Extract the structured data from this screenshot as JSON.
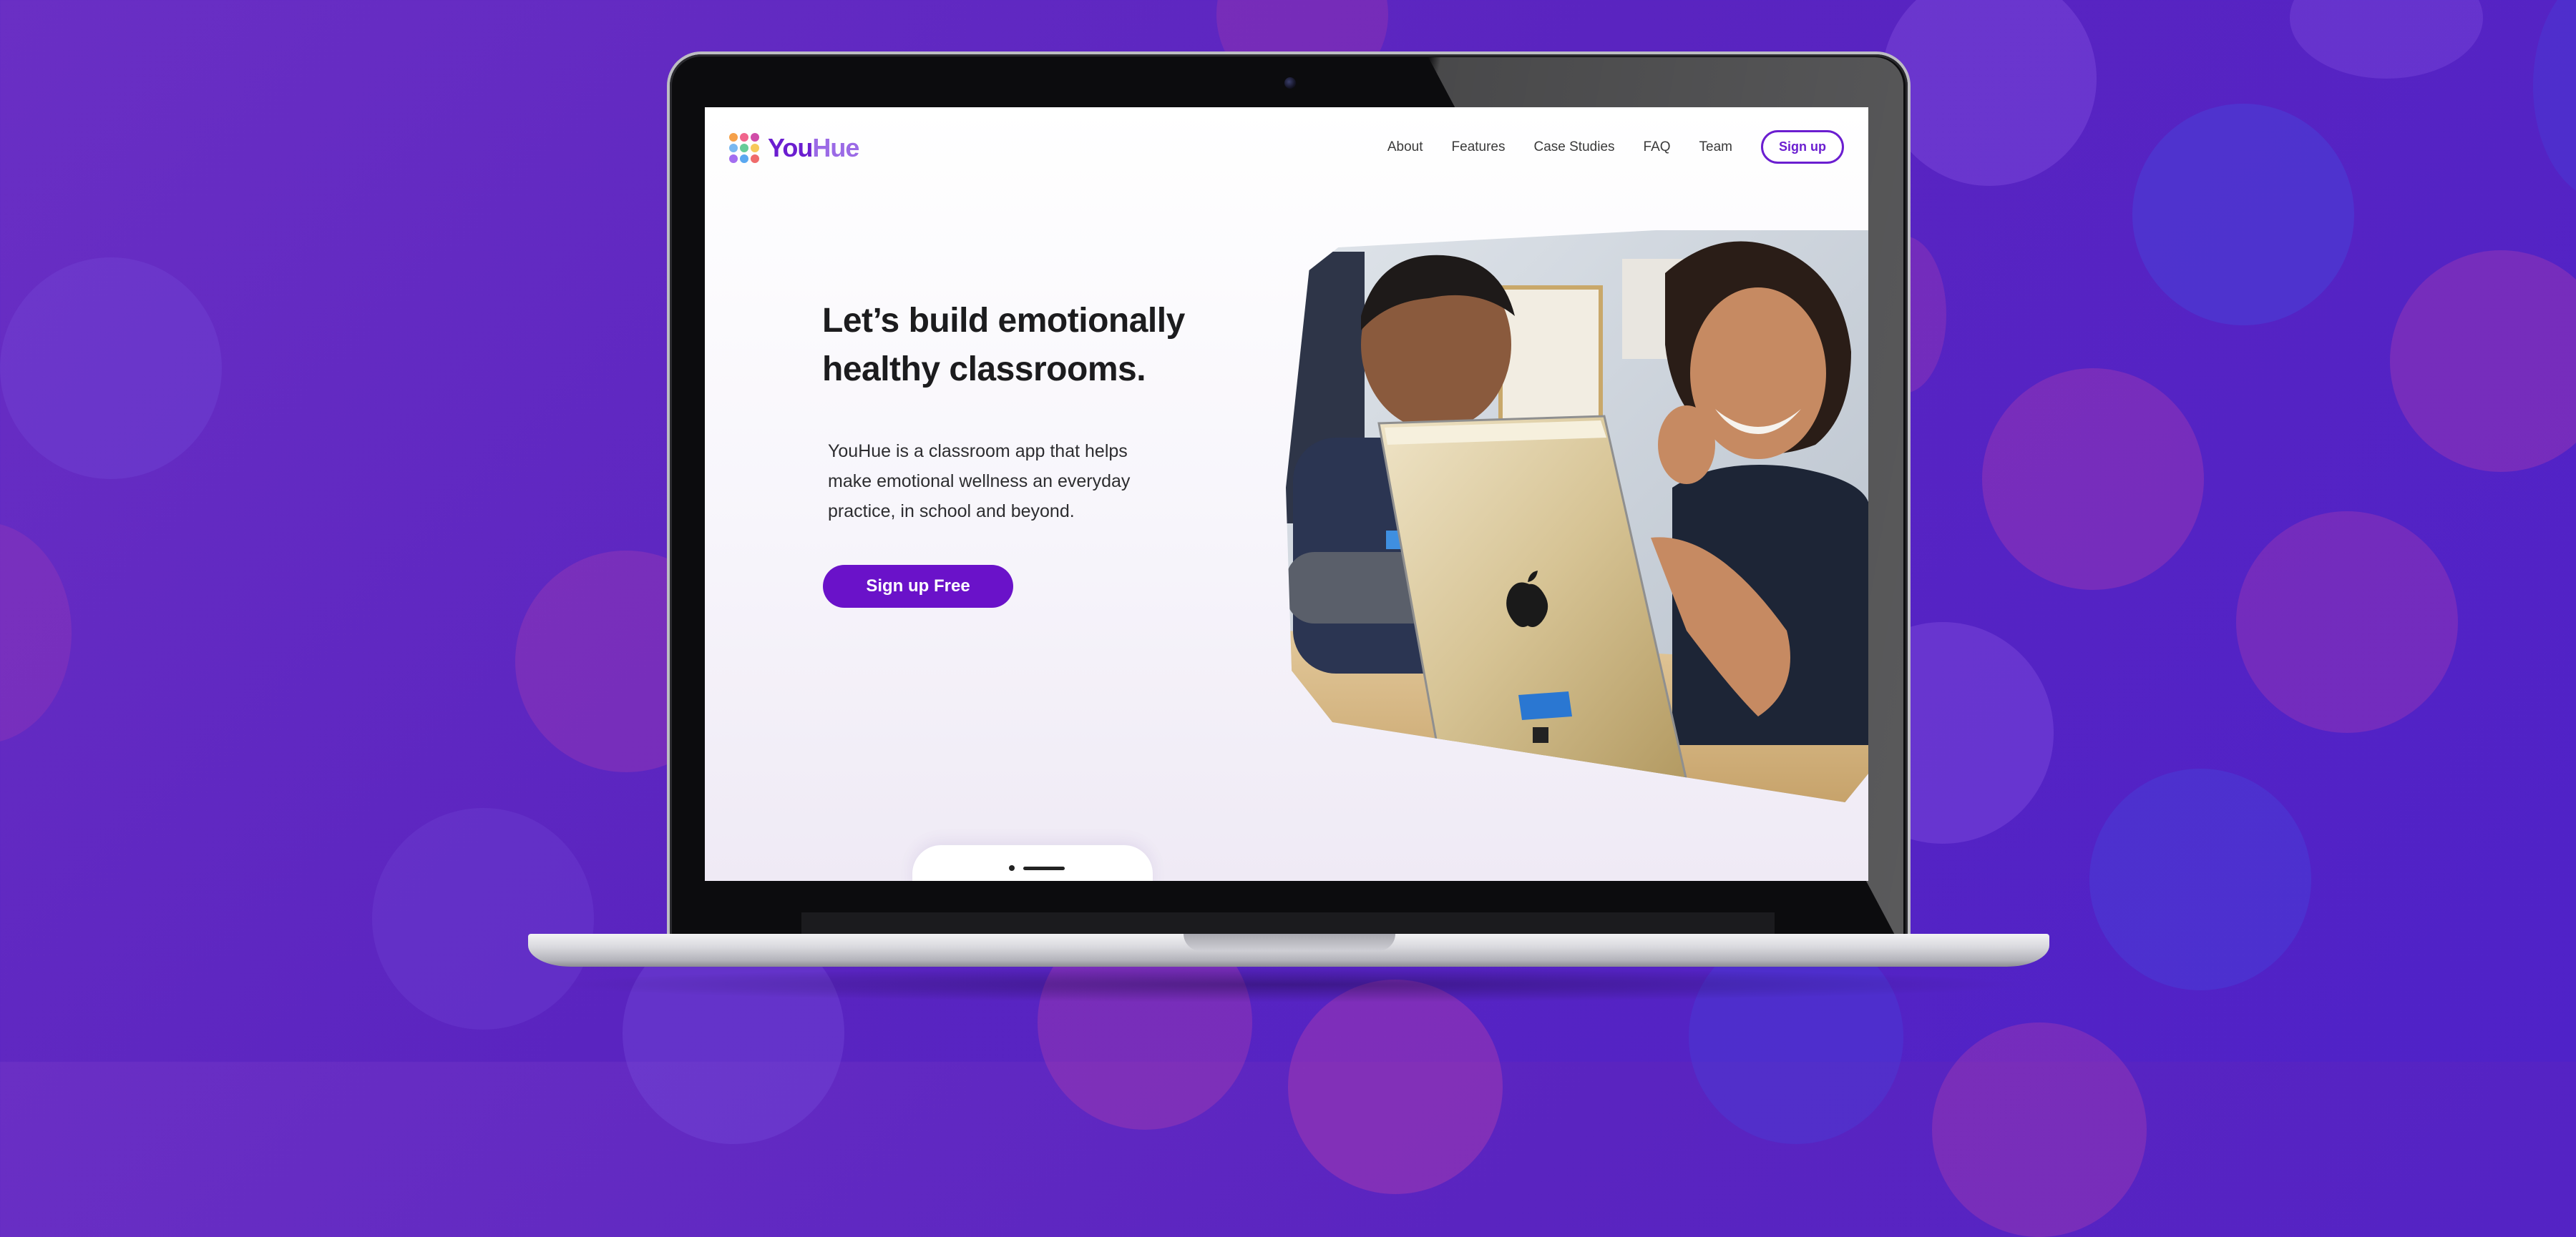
{
  "brand": {
    "name_part1": "You",
    "name_part2": "Hue",
    "logo_dot_colors": [
      "#f5a04a",
      "#f0648c",
      "#d04ca8",
      "#7ab8f0",
      "#66cc99",
      "#f7c95a",
      "#a36ef0",
      "#5aa8f0",
      "#ef6b6b"
    ]
  },
  "nav": {
    "links": [
      "About",
      "Features",
      "Case Studies",
      "FAQ",
      "Team"
    ],
    "signup_label": "Sign up"
  },
  "hero": {
    "title_line1": "Let’s build emotionally",
    "title_line2": "healthy classrooms.",
    "subtitle_line1": "YouHue is a classroom app that helps",
    "subtitle_line2": "make emotional wellness an everyday",
    "subtitle_line3": "practice, in school and beyond.",
    "cta_label": "Sign up Free"
  },
  "colors": {
    "accent": "#6a12c9",
    "background": "#5a24c0"
  }
}
